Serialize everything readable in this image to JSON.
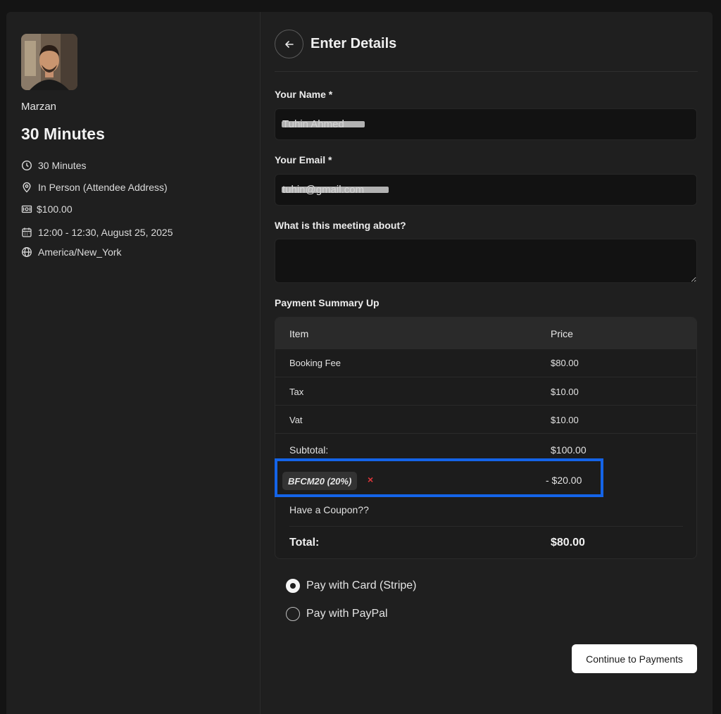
{
  "host": {
    "name": "Marzan"
  },
  "event": {
    "title": "30 Minutes",
    "duration": "30 Minutes",
    "location": "In Person (Attendee Address)",
    "price": "$100.00",
    "datetime": "12:00 - 12:30, August 25, 2025",
    "timezone": "America/New_York"
  },
  "form": {
    "title": "Enter Details",
    "name_label": "Your Name *",
    "name_value": "Tuhin Ahmed",
    "email_label": "Your Email *",
    "email_value": "tuhin@gmail.com",
    "about_label": "What is this meeting about?",
    "about_value": ""
  },
  "summary": {
    "title": "Payment Summary Up",
    "col_item": "Item",
    "col_price": "Price",
    "rows": [
      {
        "item": "Booking Fee",
        "price": "$80.00"
      },
      {
        "item": "Tax",
        "price": "$10.00"
      },
      {
        "item": "Vat",
        "price": "$10.00"
      }
    ],
    "subtotal_label": "Subtotal:",
    "subtotal_value": "$100.00",
    "coupon_code": "BFCM20 (20%)",
    "coupon_remove": "×",
    "coupon_discount": "- $20.00",
    "coupon_prompt": "Have a Coupon??",
    "total_label": "Total:",
    "total_value": "$80.00"
  },
  "payment": {
    "options": [
      {
        "label": "Pay with Card (Stripe)",
        "selected": true
      },
      {
        "label": "Pay with PayPal",
        "selected": false
      }
    ],
    "continue_label": "Continue to Payments"
  },
  "colors": {
    "highlight": "#1464e8",
    "remove": "#e0363a"
  }
}
